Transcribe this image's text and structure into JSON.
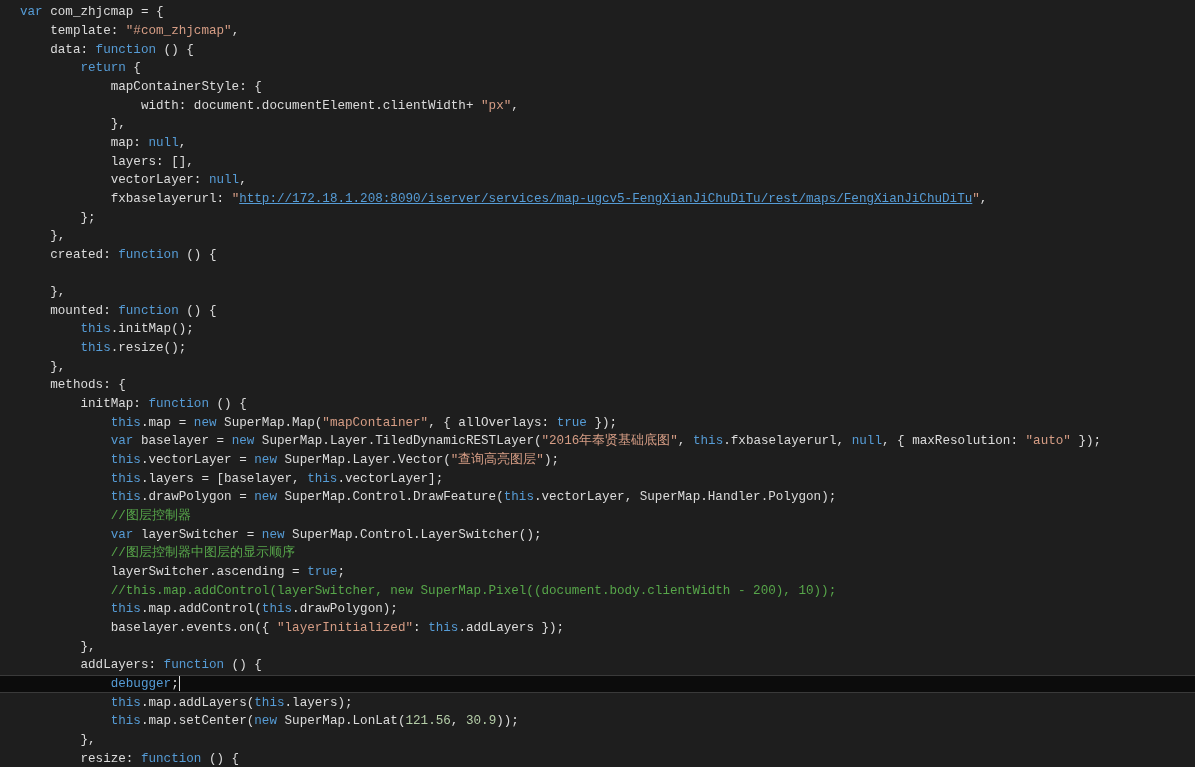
{
  "editor": {
    "lines": [
      {
        "current": false,
        "tokens": [
          {
            "kind": "kw",
            "text": "var"
          },
          {
            "kind": "id",
            "text": " com_zhjcmap = {"
          }
        ]
      },
      {
        "current": false,
        "tokens": [
          {
            "kind": "id",
            "text": "    template: "
          },
          {
            "kind": "str",
            "text": "\"#com_zhjcmap\""
          },
          {
            "kind": "id",
            "text": ","
          }
        ]
      },
      {
        "current": false,
        "tokens": [
          {
            "kind": "id",
            "text": "    data: "
          },
          {
            "kind": "kw",
            "text": "function"
          },
          {
            "kind": "id",
            "text": " () {"
          }
        ]
      },
      {
        "current": false,
        "tokens": [
          {
            "kind": "kw",
            "text": "        return"
          },
          {
            "kind": "id",
            "text": " {"
          }
        ]
      },
      {
        "current": false,
        "tokens": [
          {
            "kind": "id",
            "text": "            mapContainerStyle: {"
          }
        ]
      },
      {
        "current": false,
        "tokens": [
          {
            "kind": "id",
            "text": "                width: document.documentElement.clientWidth+ "
          },
          {
            "kind": "str",
            "text": "\"px\""
          },
          {
            "kind": "id",
            "text": ","
          }
        ]
      },
      {
        "current": false,
        "tokens": [
          {
            "kind": "id",
            "text": "            },"
          }
        ]
      },
      {
        "current": false,
        "tokens": [
          {
            "kind": "id",
            "text": "            map: "
          },
          {
            "kind": "kw",
            "text": "null"
          },
          {
            "kind": "id",
            "text": ","
          }
        ]
      },
      {
        "current": false,
        "tokens": [
          {
            "kind": "id",
            "text": "            layers: [],"
          }
        ]
      },
      {
        "current": false,
        "tokens": [
          {
            "kind": "id",
            "text": "            vectorLayer: "
          },
          {
            "kind": "kw",
            "text": "null"
          },
          {
            "kind": "id",
            "text": ","
          }
        ]
      },
      {
        "current": false,
        "tokens": [
          {
            "kind": "id",
            "text": "            fxbaselayerurl: "
          },
          {
            "kind": "str",
            "text": "\""
          },
          {
            "kind": "link",
            "text": "http://172.18.1.208:8090/iserver/services/map-ugcv5-FengXianJiChuDiTu/rest/maps/FengXianJiChuDiTu"
          },
          {
            "kind": "str",
            "text": "\""
          },
          {
            "kind": "id",
            "text": ","
          }
        ]
      },
      {
        "current": false,
        "tokens": [
          {
            "kind": "id",
            "text": "        };"
          }
        ]
      },
      {
        "current": false,
        "tokens": [
          {
            "kind": "id",
            "text": "    },"
          }
        ]
      },
      {
        "current": false,
        "tokens": [
          {
            "kind": "id",
            "text": "    created: "
          },
          {
            "kind": "kw",
            "text": "function"
          },
          {
            "kind": "id",
            "text": " () {"
          }
        ]
      },
      {
        "current": false
      },
      {
        "current": false,
        "tokens": [
          {
            "kind": "id",
            "text": "    },"
          }
        ]
      },
      {
        "current": false,
        "tokens": [
          {
            "kind": "id",
            "text": "    mounted: "
          },
          {
            "kind": "kw",
            "text": "function"
          },
          {
            "kind": "id",
            "text": " () {"
          }
        ]
      },
      {
        "current": false,
        "tokens": [
          {
            "kind": "kw",
            "text": "        this"
          },
          {
            "kind": "id",
            "text": ".initMap();"
          }
        ]
      },
      {
        "current": false,
        "tokens": [
          {
            "kind": "kw",
            "text": "        this"
          },
          {
            "kind": "id",
            "text": ".resize();"
          }
        ]
      },
      {
        "current": false,
        "tokens": [
          {
            "kind": "id",
            "text": "    },"
          }
        ]
      },
      {
        "current": false,
        "tokens": [
          {
            "kind": "id",
            "text": "    methods: {"
          }
        ]
      },
      {
        "current": false,
        "tokens": [
          {
            "kind": "id",
            "text": "        initMap: "
          },
          {
            "kind": "kw",
            "text": "function"
          },
          {
            "kind": "id",
            "text": " () {"
          }
        ]
      },
      {
        "current": false,
        "tokens": [
          {
            "kind": "kw",
            "text": "            this"
          },
          {
            "kind": "id",
            "text": ".map = "
          },
          {
            "kind": "kw",
            "text": "new"
          },
          {
            "kind": "id",
            "text": " SuperMap.Map("
          },
          {
            "kind": "str",
            "text": "\"mapContainer\""
          },
          {
            "kind": "id",
            "text": ", { allOverlays: "
          },
          {
            "kind": "kw",
            "text": "true"
          },
          {
            "kind": "id",
            "text": " });"
          }
        ]
      },
      {
        "current": false,
        "tokens": [
          {
            "kind": "kw",
            "text": "            var"
          },
          {
            "kind": "id",
            "text": " baselayer = "
          },
          {
            "kind": "kw",
            "text": "new"
          },
          {
            "kind": "id",
            "text": " SuperMap.Layer.TiledDynamicRESTLayer("
          },
          {
            "kind": "str",
            "text": "\"2016年奉贤基础底图\""
          },
          {
            "kind": "id",
            "text": ", "
          },
          {
            "kind": "kw",
            "text": "this"
          },
          {
            "kind": "id",
            "text": ".fxbaselayerurl, "
          },
          {
            "kind": "kw",
            "text": "null"
          },
          {
            "kind": "id",
            "text": ", { maxResolution: "
          },
          {
            "kind": "str",
            "text": "\"auto\""
          },
          {
            "kind": "id",
            "text": " });"
          }
        ]
      },
      {
        "current": false,
        "tokens": [
          {
            "kind": "kw",
            "text": "            this"
          },
          {
            "kind": "id",
            "text": ".vectorLayer = "
          },
          {
            "kind": "kw",
            "text": "new"
          },
          {
            "kind": "id",
            "text": " SuperMap.Layer.Vector("
          },
          {
            "kind": "str",
            "text": "\"查询高亮图层\""
          },
          {
            "kind": "id",
            "text": ");"
          }
        ]
      },
      {
        "current": false,
        "tokens": [
          {
            "kind": "kw",
            "text": "            this"
          },
          {
            "kind": "id",
            "text": ".layers = [baselayer, "
          },
          {
            "kind": "kw",
            "text": "this"
          },
          {
            "kind": "id",
            "text": ".vectorLayer];"
          }
        ]
      },
      {
        "current": false,
        "tokens": [
          {
            "kind": "kw",
            "text": "            this"
          },
          {
            "kind": "id",
            "text": ".drawPolygon = "
          },
          {
            "kind": "kw",
            "text": "new"
          },
          {
            "kind": "id",
            "text": " SuperMap.Control.DrawFeature("
          },
          {
            "kind": "kw",
            "text": "this"
          },
          {
            "kind": "id",
            "text": ".vectorLayer, SuperMap.Handler.Polygon);"
          }
        ]
      },
      {
        "current": false,
        "tokens": [
          {
            "kind": "cmt",
            "text": "            //图层控制器"
          }
        ]
      },
      {
        "current": false,
        "tokens": [
          {
            "kind": "kw",
            "text": "            var"
          },
          {
            "kind": "id",
            "text": " layerSwitcher = "
          },
          {
            "kind": "kw",
            "text": "new"
          },
          {
            "kind": "id",
            "text": " SuperMap.Control.LayerSwitcher();"
          }
        ]
      },
      {
        "current": false,
        "tokens": [
          {
            "kind": "cmt",
            "text": "            //图层控制器中图层的显示顺序"
          }
        ]
      },
      {
        "current": false,
        "tokens": [
          {
            "kind": "id",
            "text": "            layerSwitcher.ascending = "
          },
          {
            "kind": "kw",
            "text": "true"
          },
          {
            "kind": "id",
            "text": ";"
          }
        ]
      },
      {
        "current": false,
        "tokens": [
          {
            "kind": "cmt",
            "text": "            //this.map.addControl(layerSwitcher, new SuperMap.Pixel((document.body.clientWidth - 200), 10));"
          }
        ]
      },
      {
        "current": false,
        "tokens": [
          {
            "kind": "kw",
            "text": "            this"
          },
          {
            "kind": "id",
            "text": ".map.addControl("
          },
          {
            "kind": "kw",
            "text": "this"
          },
          {
            "kind": "id",
            "text": ".drawPolygon);"
          }
        ]
      },
      {
        "current": false,
        "tokens": [
          {
            "kind": "id",
            "text": "            baselayer.events.on({ "
          },
          {
            "kind": "str",
            "text": "\"layerInitialized\""
          },
          {
            "kind": "id",
            "text": ": "
          },
          {
            "kind": "kw",
            "text": "this"
          },
          {
            "kind": "id",
            "text": ".addLayers });"
          }
        ]
      },
      {
        "current": false,
        "tokens": [
          {
            "kind": "id",
            "text": "        },"
          }
        ]
      },
      {
        "current": false,
        "tokens": [
          {
            "kind": "id",
            "text": "        addLayers: "
          },
          {
            "kind": "kw",
            "text": "function"
          },
          {
            "kind": "id",
            "text": " () {"
          }
        ]
      },
      {
        "current": true,
        "tokens": [
          {
            "kind": "kw",
            "text": "            debugger"
          },
          {
            "kind": "id",
            "text": ";"
          }
        ]
      },
      {
        "current": false,
        "tokens": [
          {
            "kind": "kw",
            "text": "            this"
          },
          {
            "kind": "id",
            "text": ".map.addLayers("
          },
          {
            "kind": "kw",
            "text": "this"
          },
          {
            "kind": "id",
            "text": ".layers);"
          }
        ]
      },
      {
        "current": false,
        "tokens": [
          {
            "kind": "kw",
            "text": "            this"
          },
          {
            "kind": "id",
            "text": ".map.setCenter("
          },
          {
            "kind": "kw",
            "text": "new"
          },
          {
            "kind": "id",
            "text": " SuperMap.LonLat("
          },
          {
            "kind": "num",
            "text": "121.56"
          },
          {
            "kind": "id",
            "text": ", "
          },
          {
            "kind": "num",
            "text": "30.9"
          },
          {
            "kind": "id",
            "text": "));"
          }
        ]
      },
      {
        "current": false,
        "tokens": [
          {
            "kind": "id",
            "text": "        },"
          }
        ]
      },
      {
        "current": false,
        "tokens": [
          {
            "kind": "id",
            "text": "        resize: "
          },
          {
            "kind": "kw",
            "text": "function"
          },
          {
            "kind": "id",
            "text": " () {"
          }
        ]
      }
    ]
  }
}
